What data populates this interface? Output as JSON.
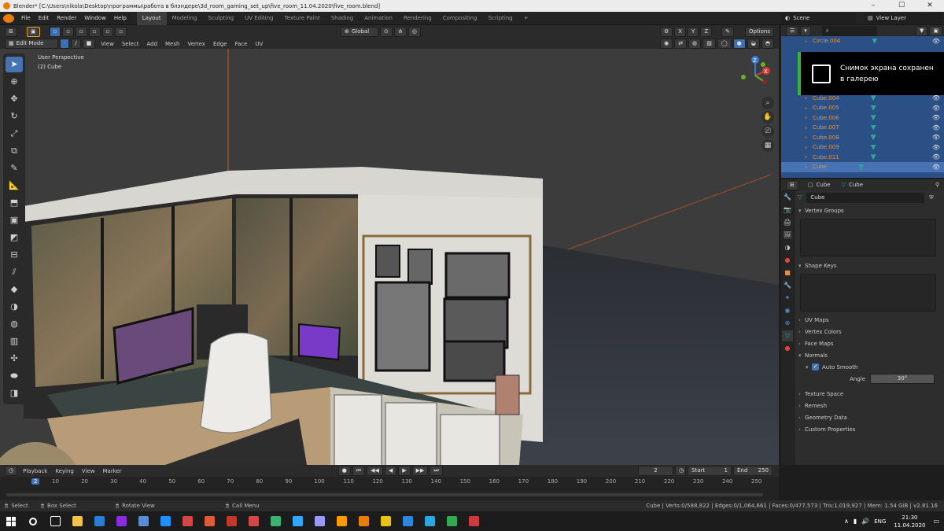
{
  "window": {
    "title": "Blender* [C:\\Users\\nikola\\Desktop\\программы\\работа в блэндере\\3d_room_gaming_set_up\\five_room_11.04.2020\\five_room.blend]"
  },
  "menus": [
    "File",
    "Edit",
    "Render",
    "Window",
    "Help"
  ],
  "workspaces": [
    "Layout",
    "Modeling",
    "Sculpting",
    "UV Editing",
    "Texture Paint",
    "Shading",
    "Animation",
    "Rendering",
    "Compositing",
    "Scripting"
  ],
  "active_workspace": "Layout",
  "scene": {
    "label": "Scene",
    "view_layer": "View Layer"
  },
  "viewport": {
    "mode": "Edit Mode",
    "menus": [
      "View",
      "Select",
      "Add",
      "Mesh",
      "Vertex",
      "Edge",
      "Face",
      "UV"
    ],
    "transform": "Global",
    "options": "Options",
    "overlay_title": "User Perspective",
    "overlay_object": "(2) Cube",
    "gizmo": {
      "x": "X",
      "y": "Y",
      "z": "Z"
    },
    "axis_toggles": [
      "X",
      "Y",
      "Z"
    ]
  },
  "outliner": {
    "items": [
      {
        "name": "Circle.004"
      },
      {
        "name": "Cube.004"
      },
      {
        "name": "Cube.005"
      },
      {
        "name": "Cube.006"
      },
      {
        "name": "Cube.007"
      },
      {
        "name": "Cube.008"
      },
      {
        "name": "Cube.009"
      },
      {
        "name": "Cube.011"
      },
      {
        "name": "Cube"
      }
    ]
  },
  "toast": {
    "line1": "Снимок экрана сохранен",
    "line2": "в галерею"
  },
  "properties": {
    "header_object": "Cube",
    "header_data": "Cube",
    "data_name": "Cube",
    "sections": {
      "vertex_groups": "Vertex Groups",
      "shape_keys": "Shape Keys",
      "uv_maps": "UV Maps",
      "vertex_colors": "Vertex Colors",
      "face_maps": "Face Maps",
      "normals": "Normals",
      "auto_smooth": "Auto Smooth",
      "angle_label": "Angle",
      "angle_value": "30°",
      "texture_space": "Texture Space",
      "remesh": "Remesh",
      "geometry_data": "Geometry Data",
      "custom_properties": "Custom Properties"
    }
  },
  "timeline": {
    "menus": [
      "Playback",
      "Keying",
      "View",
      "Marker"
    ],
    "current_frame": "2",
    "start_label": "Start",
    "start": "1",
    "end_label": "End",
    "end": "250",
    "ticks": [
      "2",
      "10",
      "20",
      "30",
      "40",
      "50",
      "60",
      "70",
      "80",
      "90",
      "100",
      "110",
      "120",
      "130",
      "140",
      "150",
      "160",
      "170",
      "180",
      "190",
      "200",
      "210",
      "220",
      "230",
      "240",
      "250"
    ]
  },
  "status": {
    "select": "Select",
    "box_select": "Box Select",
    "rotate_view": "Rotate View",
    "call_menu": "Call Menu",
    "stats": "Cube | Verts:0/588,822 | Edges:0/1,064,661 | Faces:0/477,573 | Tris:1,019,927 | Mem: 1.54 GiB | v2.81.16"
  },
  "taskbar": {
    "lang": "ENG",
    "time": "21:30",
    "date": "11.04.2020",
    "apps": [
      {
        "name": "search",
        "color": "#1c1c1c"
      },
      {
        "name": "task-view",
        "color": "#1c1c1c"
      },
      {
        "name": "explorer",
        "color": "#f2c14e"
      },
      {
        "name": "store",
        "color": "#2b7cd3"
      },
      {
        "name": "app-purple",
        "color": "#8a2be2"
      },
      {
        "name": "app-blue",
        "color": "#5a8dd6"
      },
      {
        "name": "edge",
        "color": "#1e90ff"
      },
      {
        "name": "app-red",
        "color": "#d64545"
      },
      {
        "name": "app-red2",
        "color": "#e05a3a"
      },
      {
        "name": "app-red3",
        "color": "#c0392b"
      },
      {
        "name": "app-red4",
        "color": "#d04848"
      },
      {
        "name": "app-green",
        "color": "#3cb371"
      },
      {
        "name": "photoshop",
        "color": "#31a8ff"
      },
      {
        "name": "premiere",
        "color": "#9999ff"
      },
      {
        "name": "illustrator",
        "color": "#ff9a00"
      },
      {
        "name": "blender",
        "color": "#e87d0d"
      },
      {
        "name": "app-m",
        "color": "#e8c31b"
      },
      {
        "name": "app-blue2",
        "color": "#2e86de"
      },
      {
        "name": "telegram",
        "color": "#2ca5e0"
      },
      {
        "name": "chrome",
        "color": "#34a853"
      },
      {
        "name": "app-red5",
        "color": "#cc3b3b"
      }
    ]
  }
}
